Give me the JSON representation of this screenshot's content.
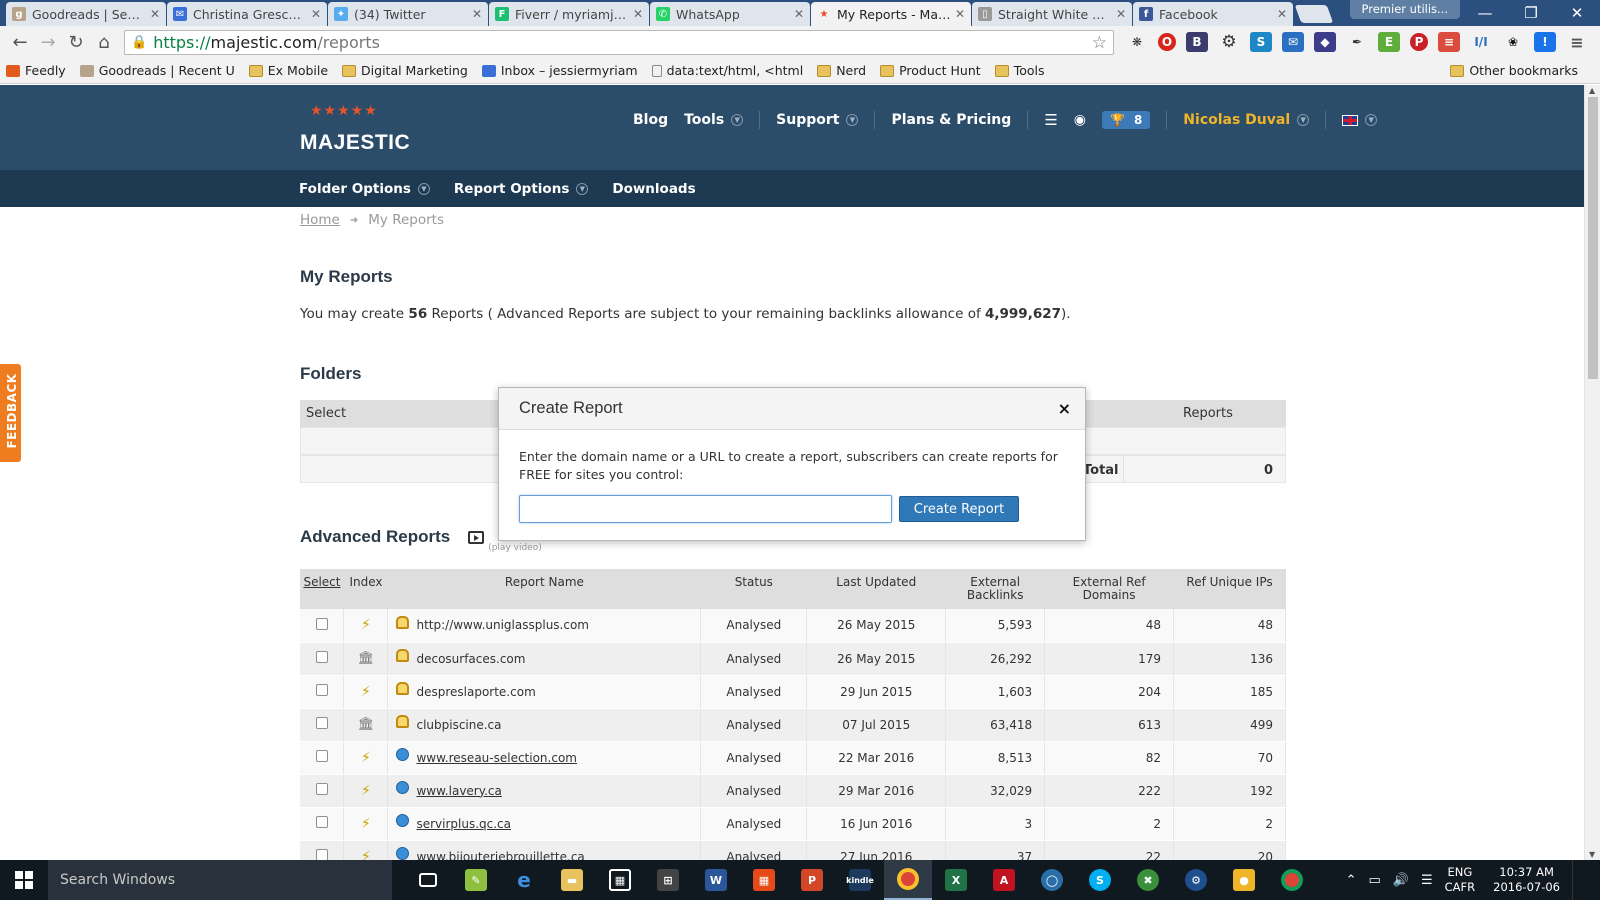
{
  "browser": {
    "tabs": [
      {
        "title": "Goodreads | Search",
        "favicon": "g",
        "color": "#b5a38a"
      },
      {
        "title": "Christina Greschner",
        "favicon": "mail",
        "color": "#3a6fd8"
      },
      {
        "title": "(34) Twitter",
        "favicon": "twitter",
        "color": "#55acee"
      },
      {
        "title": "Fiverr / myriamjessie",
        "favicon": "F",
        "color": "#1dbf73"
      },
      {
        "title": "WhatsApp",
        "favicon": "wa",
        "color": "#25d366"
      },
      {
        "title": "My Reports - Majestic",
        "favicon": "star",
        "color": "#e84b2c",
        "active": true
      },
      {
        "title": "Straight White Boys",
        "favicon": "doc",
        "color": "#9a9a9a"
      },
      {
        "title": "Facebook",
        "favicon": "f",
        "color": "#3b5998"
      }
    ],
    "profile": "Premier utilis...",
    "url_scheme": "https://",
    "url_host": "majestic.com",
    "url_path": "/reports",
    "bookmarks": [
      {
        "label": "Feedly",
        "kind": "site",
        "color": "#e25a1c"
      },
      {
        "label": "Goodreads | Recent U",
        "kind": "site",
        "color": "#b5a38a"
      },
      {
        "label": "Ex Mobile",
        "kind": "folder"
      },
      {
        "label": "Digital Marketing",
        "kind": "folder"
      },
      {
        "label": "Inbox – jessiermyriam",
        "kind": "site",
        "color": "#3a6fd8"
      },
      {
        "label": "data:text/html, <html",
        "kind": "page"
      },
      {
        "label": "Nerd",
        "kind": "folder"
      },
      {
        "label": "Product Hunt",
        "kind": "folder"
      },
      {
        "label": "Tools",
        "kind": "folder"
      }
    ],
    "other_bookmarks": "Other bookmarks"
  },
  "site": {
    "logo": "MAJESTIC",
    "nav": {
      "blog": "Blog",
      "tools": "Tools",
      "support": "Support",
      "plans": "Plans & Pricing",
      "trophy_count": "8",
      "user": "Nicolas Duval"
    },
    "subnav": {
      "folder_options": "Folder Options",
      "report_options": "Report Options",
      "downloads": "Downloads"
    },
    "breadcrumb": {
      "home": "Home",
      "current": "My Reports"
    },
    "feedback": "FEEDBACK"
  },
  "main": {
    "title": "My Reports",
    "intro_prefix": "You may create ",
    "intro_count": "56",
    "intro_mid": " Reports ( Advanced Reports are subject to your remaining backlinks allowance of ",
    "intro_allowance": "4,999,627",
    "intro_suffix": ").",
    "folders": {
      "title": "Folders",
      "col_select": "Select",
      "col_reports": "Reports",
      "total_label": "Total",
      "total_value": "0"
    },
    "advanced": {
      "title": "Advanced Reports",
      "play_video": "(play video)",
      "columns": {
        "select": "Select",
        "index": "Index",
        "name": "Report Name",
        "status": "Status",
        "updated": "Last Updated",
        "backlinks": "External Backlinks",
        "refdomains": "External Ref Domains",
        "ips": "Ref Unique IPs"
      },
      "rows": [
        {
          "index": "fresh",
          "icon": "lock",
          "name": "http://www.uniglassplus.com",
          "link": false,
          "status": "Analysed",
          "updated": "26 May 2015",
          "backlinks": "5,593",
          "refdomains": "48",
          "ips": "48"
        },
        {
          "index": "historic",
          "icon": "lock",
          "name": "decosurfaces.com",
          "link": false,
          "status": "Analysed",
          "updated": "26 May 2015",
          "backlinks": "26,292",
          "refdomains": "179",
          "ips": "136"
        },
        {
          "index": "fresh",
          "icon": "lock",
          "name": "despreslaporte.com",
          "link": false,
          "status": "Analysed",
          "updated": "29 Jun 2015",
          "backlinks": "1,603",
          "refdomains": "204",
          "ips": "185"
        },
        {
          "index": "historic",
          "icon": "lock",
          "name": "clubpiscine.ca",
          "link": false,
          "status": "Analysed",
          "updated": "07 Jul 2015",
          "backlinks": "63,418",
          "refdomains": "613",
          "ips": "499"
        },
        {
          "index": "fresh",
          "icon": "refresh",
          "name": "www.reseau-selection.com",
          "link": true,
          "status": "Analysed",
          "updated": "22 Mar 2016",
          "backlinks": "8,513",
          "refdomains": "82",
          "ips": "70"
        },
        {
          "index": "fresh",
          "icon": "refresh",
          "name": "www.lavery.ca",
          "link": true,
          "status": "Analysed",
          "updated": "29 Mar 2016",
          "backlinks": "32,029",
          "refdomains": "222",
          "ips": "192"
        },
        {
          "index": "fresh",
          "icon": "refresh",
          "name": "servirplus.qc.ca",
          "link": true,
          "status": "Analysed",
          "updated": "16 Jun 2016",
          "backlinks": "3",
          "refdomains": "2",
          "ips": "2"
        },
        {
          "index": "fresh",
          "icon": "refresh",
          "name": "www.bijouteriebrouillette.ca",
          "link": true,
          "status": "Analysed",
          "updated": "27 Jun 2016",
          "backlinks": "37",
          "refdomains": "22",
          "ips": "20"
        }
      ]
    }
  },
  "modal": {
    "title": "Create Report",
    "close": "×",
    "description": "Enter the domain name or a URL to create a report, subscribers can create reports for FREE for sites you control:",
    "input_value": "",
    "button": "Create Report"
  },
  "taskbar": {
    "search_placeholder": "Search Windows",
    "lang_top": "ENG",
    "lang_bottom": "CAFR",
    "time": "10:37 AM",
    "date": "2016-07-06"
  }
}
